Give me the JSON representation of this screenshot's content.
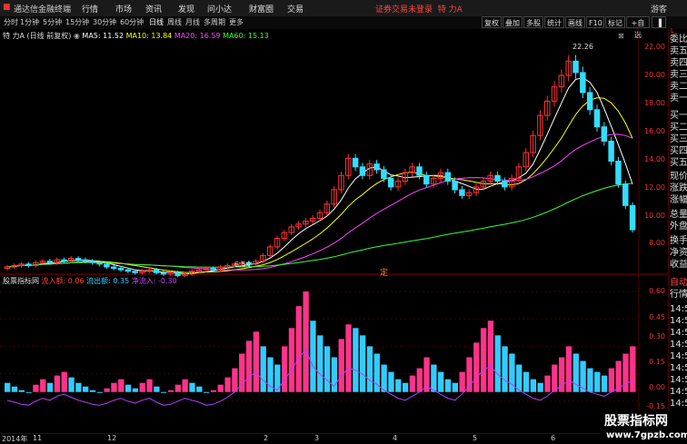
{
  "menu": {
    "app_name": "通达信金融终端",
    "items": [
      "行情",
      "市场",
      "资讯",
      "发现",
      "问小达",
      "财富圈",
      "交易"
    ],
    "alert": "证券交易未登录",
    "stock_short": "特 力A",
    "guest": "游客"
  },
  "toolbar": {
    "periods": [
      "分时",
      "1分钟",
      "5分钟",
      "15分钟",
      "30分钟",
      "60分钟",
      "日线",
      "周线",
      "月线",
      "多周期",
      "更多"
    ],
    "active": "日线",
    "buttons": [
      "复权",
      "叠加",
      "多股",
      "统计",
      "画线",
      "F10",
      "标记",
      "+自选"
    ]
  },
  "main_legend": {
    "title": "特 力A (日线 前复权)",
    "ma5": "MA5: 11.52",
    "ma10": "MA10: 13.84",
    "ma20": "MA20: 16.59",
    "ma60": "MA60: 15.13",
    "colors": {
      "ma5": "#ffffff",
      "ma10": "#ffff00",
      "ma20": "#ff44ff",
      "ma60": "#33ff33"
    }
  },
  "ind_legend": {
    "name": "股票指标网",
    "in": "流入额: 0.06",
    "out": "流出额: 0.35",
    "net": "净流入: -0.30"
  },
  "price_axis": [
    "22.00",
    "20.00",
    "18.00",
    "16.00",
    "14.00",
    "12.00",
    "10.00",
    "8.00"
  ],
  "ind_axis": [
    "0.60",
    "0.45",
    "0.30",
    "0.15",
    "0.00",
    "-0.15"
  ],
  "high_label": "22.26",
  "low_label": "6.54",
  "mid_marker": "定",
  "x_axis": [
    "2014年",
    "11",
    "12",
    "2",
    "3",
    "4",
    "5",
    "6"
  ],
  "right_panel_top": [
    "委比",
    "卖五",
    "卖四",
    "卖三",
    "卖二",
    "卖一",
    "买一",
    "买二",
    "买三",
    "买四",
    "买五",
    "现价",
    "涨跌",
    "涨幅",
    "总量",
    "外盘",
    "换手",
    "净资",
    "收益"
  ],
  "right_panel_bottom": [
    "自动",
    "行情",
    "14:5",
    "14:5",
    "14:5",
    "14:5",
    "14:5",
    "14:5",
    "14:5",
    "14:5",
    "14:5"
  ],
  "watermark": {
    "line1": "股票指标网",
    "line2": "www.7gpzb.com"
  },
  "chart_data": {
    "type": "candlestick",
    "closes": [
      7.2,
      7.3,
      7.4,
      7.3,
      7.5,
      7.6,
      7.5,
      7.7,
      7.6,
      7.8,
      7.7,
      7.6,
      7.5,
      7.4,
      7.2,
      7.1,
      7.0,
      6.9,
      6.8,
      6.9,
      7.0,
      6.8,
      6.7,
      6.8,
      6.6,
      6.7,
      6.9,
      7.0,
      7.1,
      7.0,
      7.2,
      7.3,
      7.4,
      7.5,
      7.4,
      7.6,
      8.0,
      8.6,
      9.2,
      9.6,
      10.0,
      10.2,
      10.4,
      10.6,
      11.0,
      11.6,
      12.6,
      13.6,
      14.8,
      14.2,
      13.6,
      14.4,
      14.0,
      13.4,
      12.8,
      13.2,
      13.8,
      14.2,
      13.6,
      13.0,
      13.4,
      13.8,
      13.2,
      12.6,
      12.2,
      12.4,
      12.8,
      13.2,
      13.6,
      13.2,
      12.8,
      13.4,
      14.2,
      15.2,
      16.4,
      17.8,
      18.8,
      19.8,
      20.6,
      21.6,
      20.8,
      19.4,
      18.2,
      17.0,
      16.0,
      14.6,
      13.0,
      11.5,
      9.8
    ],
    "opens": [
      7.1,
      7.2,
      7.3,
      7.4,
      7.3,
      7.5,
      7.6,
      7.5,
      7.7,
      7.6,
      7.8,
      7.7,
      7.6,
      7.5,
      7.4,
      7.2,
      7.1,
      7.0,
      6.9,
      6.8,
      6.9,
      7.0,
      6.8,
      6.7,
      6.8,
      6.6,
      6.7,
      6.9,
      7.0,
      7.1,
      7.0,
      7.2,
      7.3,
      7.4,
      7.5,
      7.4,
      7.6,
      8.0,
      8.6,
      9.2,
      9.6,
      10.0,
      10.2,
      10.4,
      10.6,
      11.0,
      11.6,
      12.6,
      13.6,
      14.8,
      14.2,
      13.6,
      14.4,
      14.0,
      13.4,
      12.8,
      13.2,
      13.8,
      14.2,
      13.6,
      13.0,
      13.4,
      13.8,
      13.2,
      12.6,
      12.2,
      12.4,
      12.8,
      13.2,
      13.6,
      13.2,
      12.8,
      13.4,
      14.2,
      15.2,
      16.4,
      17.8,
      18.8,
      19.8,
      20.6,
      21.6,
      20.8,
      19.4,
      18.2,
      17.0,
      16.0,
      14.6,
      13.0,
      11.5
    ],
    "ylim": [
      7.2,
      22.7
    ],
    "indicator": [
      0.1,
      0.08,
      0.06,
      0.05,
      0.09,
      0.12,
      0.1,
      0.14,
      0.16,
      0.13,
      0.1,
      0.08,
      0.06,
      0.05,
      0.07,
      0.1,
      0.12,
      0.09,
      0.07,
      0.1,
      0.12,
      0.08,
      0.05,
      0.06,
      0.09,
      0.12,
      0.1,
      0.08,
      0.05,
      0.06,
      0.09,
      0.13,
      0.18,
      0.26,
      0.33,
      0.38,
      0.3,
      0.24,
      0.2,
      0.3,
      0.4,
      0.52,
      0.6,
      0.44,
      0.36,
      0.3,
      0.24,
      0.34,
      0.42,
      0.4,
      0.36,
      0.3,
      0.26,
      0.2,
      0.16,
      0.12,
      0.1,
      0.14,
      0.18,
      0.24,
      0.2,
      0.16,
      0.12,
      0.1,
      0.16,
      0.24,
      0.32,
      0.4,
      0.44,
      0.36,
      0.3,
      0.26,
      0.2,
      0.16,
      0.12,
      0.1,
      0.14,
      0.2,
      0.24,
      0.3,
      0.26,
      0.22,
      0.18,
      0.16,
      0.14,
      0.18,
      0.22,
      0.26,
      0.3
    ],
    "ind_ylim": [
      -0.15,
      0.62
    ]
  }
}
